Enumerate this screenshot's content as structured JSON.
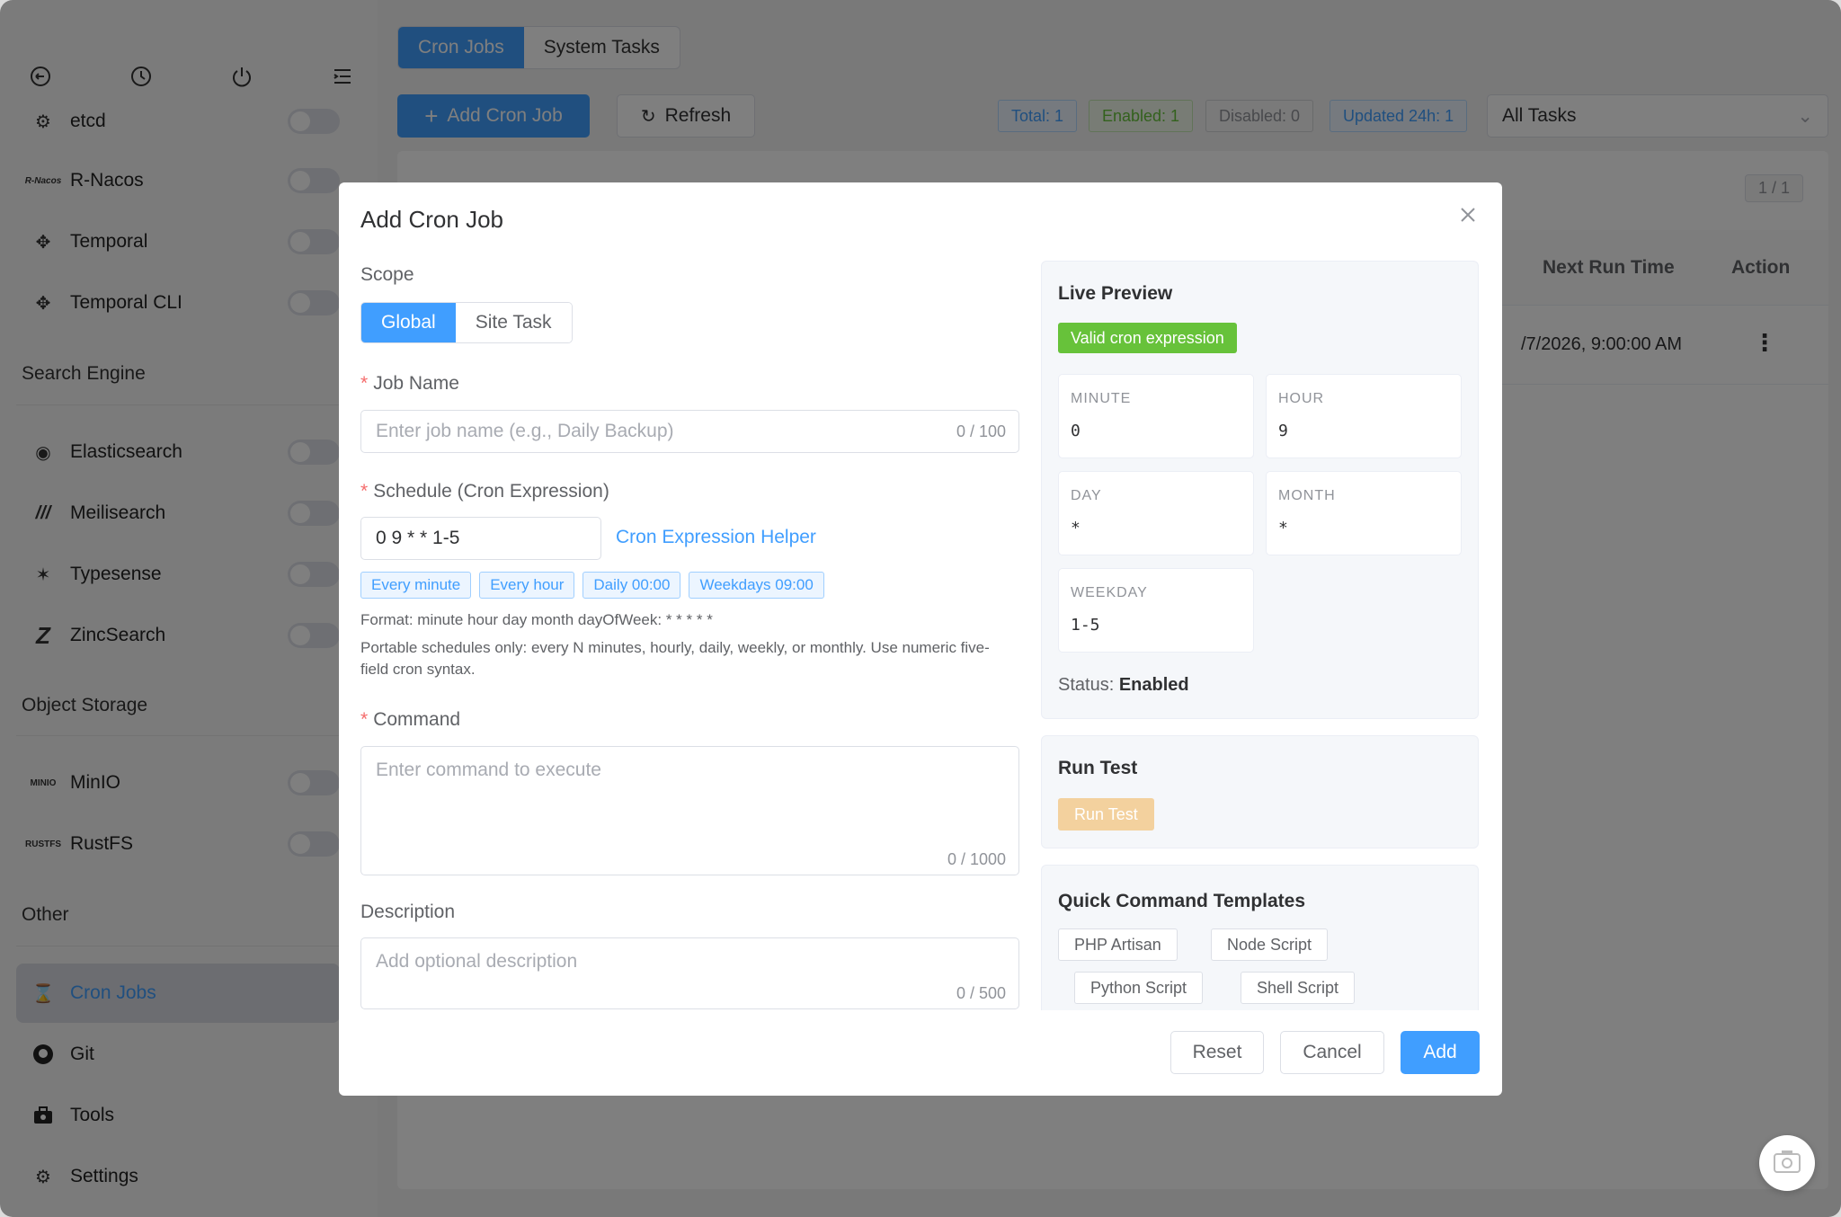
{
  "sidebar": {
    "items": [
      {
        "name": "etcd",
        "icon": "etcd-icon",
        "glyph": "⚙"
      },
      {
        "name": "R-Nacos",
        "icon": "r-nacos-logo",
        "glyph": "R-Nacos"
      },
      {
        "name": "Temporal",
        "icon": "temporal-icon",
        "glyph": "✥"
      },
      {
        "name": "Temporal CLI",
        "icon": "temporal-cli-icon",
        "glyph": "✥"
      }
    ],
    "section_search": "Search Engine",
    "search_items": [
      {
        "name": "Elasticsearch",
        "icon": "elasticsearch-icon"
      },
      {
        "name": "Meilisearch",
        "icon": "meilisearch-icon"
      },
      {
        "name": "Typesense",
        "icon": "typesense-icon"
      },
      {
        "name": "ZincSearch",
        "icon": "zincsearch-icon"
      }
    ],
    "section_storage": "Object Storage",
    "storage_items": [
      {
        "name": "MinIO",
        "icon": "minio-logo",
        "glyph": "MINIO"
      },
      {
        "name": "RustFS",
        "icon": "rustfs-logo",
        "glyph": "RUSTFS"
      }
    ],
    "section_other": "Other",
    "other_items": [
      {
        "name": "Cron Jobs",
        "icon": "hourglass-icon"
      },
      {
        "name": "Git",
        "icon": "github-icon"
      },
      {
        "name": "Tools",
        "icon": "toolbox-icon"
      },
      {
        "name": "Settings",
        "icon": "gear-icon"
      }
    ]
  },
  "main": {
    "tabs": [
      "Cron Jobs",
      "System Tasks"
    ],
    "add_button": "Add Cron Job",
    "refresh_button": "Refresh",
    "stats": {
      "total": "Total: 1",
      "enabled": "Enabled: 1",
      "disabled": "Disabled: 0",
      "updated": "Updated 24h: 1"
    },
    "filter_select": "All Tasks",
    "pager": "1 / 1",
    "table": {
      "col_next": "Next Run Time",
      "col_action": "Action",
      "row_next": "/7/2026, 9:00:00 AM"
    }
  },
  "dialog": {
    "title": "Add Cron Job",
    "scope_label": "Scope",
    "scope_options": [
      "Global",
      "Site Task"
    ],
    "job_name_label": "Job Name",
    "job_name_placeholder": "Enter job name (e.g., Daily Backup)",
    "job_name_count": "0 / 100",
    "schedule_label": "Schedule (Cron Expression)",
    "schedule_value": "0 9 * * 1-5",
    "helper_link": "Cron Expression Helper",
    "presets": [
      "Every minute",
      "Every hour",
      "Daily 00:00",
      "Weekdays 09:00"
    ],
    "format_hint": "Format: minute hour day month dayOfWeek: * * * * *",
    "portable_hint": "Portable schedules only: every N minutes, hourly, daily, weekly, or monthly. Use numeric five-field cron syntax.",
    "command_label": "Command",
    "command_placeholder": "Enter command to execute",
    "command_count": "0 / 1000",
    "description_label": "Description",
    "description_placeholder": "Add optional description",
    "description_count": "0 / 500",
    "preview": {
      "title": "Live Preview",
      "valid": "Valid cron expression",
      "minute_key": "MINUTE",
      "minute_val": "0",
      "hour_key": "HOUR",
      "hour_val": "9",
      "day_key": "DAY",
      "day_val": "*",
      "month_key": "MONTH",
      "month_val": "*",
      "weekday_key": "WEEKDAY",
      "weekday_val": "1-5",
      "status_prefix": "Status:",
      "status_value": "Enabled"
    },
    "run_test": {
      "title": "Run Test",
      "button": "Run Test"
    },
    "templates": {
      "title": "Quick Command Templates",
      "items": [
        "PHP Artisan",
        "Node Script",
        "Python Script",
        "Shell Script"
      ]
    },
    "buttons": {
      "reset": "Reset",
      "cancel": "Cancel",
      "add": "Add"
    }
  },
  "colors": {
    "primary": "#409eff",
    "success": "#67c23a",
    "warning_light": "#f3d19e",
    "danger": "#f56c6c"
  }
}
